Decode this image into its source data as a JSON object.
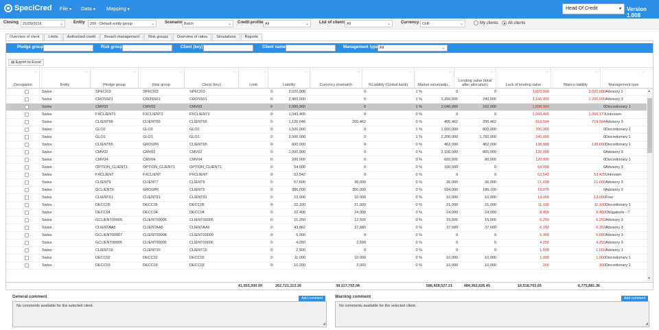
{
  "app": {
    "name": "SpeciCred",
    "version": "Version 1.008",
    "role": "Head Of Credit"
  },
  "menu": [
    "File",
    "Data",
    "Mapping"
  ],
  "filters": {
    "closing_label": "Closing",
    "closing": "21/09/2016",
    "entity_label": "Entity",
    "entity": "200 - Default entity group",
    "scenario_label": "Scenario",
    "scenario": "Batch",
    "credit_profile_label": "Credit profile",
    "credit_profile": "All",
    "list_label": "List of clients",
    "list": "All",
    "currency_label": "Currency",
    "currency": "CHF",
    "my_clients": "My clients",
    "all_clients": "All clients",
    "selected_scope": "all"
  },
  "tabs": [
    "Overview of client",
    "Limits",
    "Authorised credit",
    "Breach management",
    "Risk groups",
    "Overview of ratios",
    "Simulations",
    "Reports"
  ],
  "search": {
    "pledge": "Pledge group",
    "risk": "Risk group",
    "client": "Client (key)",
    "name": "Client name",
    "mtype": "Management type",
    "mtype_value": "All"
  },
  "export": "Export to Excel",
  "columns": [
    "Derogation",
    "Entity",
    "Pledge group",
    "Risk group",
    "Client (key)",
    "Limit",
    "Liability",
    "Currency mismatch",
    "%Liability (Global bank)",
    "Market value(adju...",
    "Lending value (total after allocation)",
    "Lack of lending value",
    "Blanco liability",
    "Management type"
  ],
  "rows": [
    [
      "Swiss",
      "SPECI03",
      "SPECI03",
      "SPECI03",
      "0",
      "3,020,000",
      "0",
      "1 %",
      "0",
      "0",
      "3,020,000",
      "3,020,000",
      "Advisory 2"
    ],
    [
      "Swiss",
      "CROSS01",
      "CROSS01",
      "CROSS01",
      "0",
      "2,400,000",
      "0",
      "1 %",
      "1,200,000",
      "240,000",
      "2,160,000",
      "1,200,000",
      "Advisory 3"
    ],
    [
      "Swiss",
      "CMV03",
      "CMV03",
      "CMV03",
      "0",
      "2,000,000",
      "0",
      "1 %",
      "2,040,000",
      "162,000",
      "1,838,000",
      "0",
      "Discretionary 1"
    ],
    [
      "Swiss",
      "FXCLIENT2",
      "FXCLIENT2",
      "FXCLIENT2",
      "0",
      "1,043,405",
      "0",
      "0 %",
      "0",
      "0",
      "1,043,405",
      "1,066,173",
      "Unknown"
    ],
    [
      "Swiss",
      "CLIENT66",
      "CLIENT66",
      "CLIENT66",
      "0",
      "1,120,046",
      "200,462",
      "0 %",
      "400,462",
      "200,462",
      "919,584",
      "719,584",
      "Advisory 3"
    ],
    [
      "Swiss",
      "GLO2",
      "GLO2",
      "GLO2",
      "0",
      "1,500,000",
      "0",
      "1 %",
      "1,000,000",
      "800,000",
      "700,000",
      "0",
      "Discretionary 1"
    ],
    [
      "Swiss",
      "GLO1",
      "GLO1",
      "GLO1",
      "0",
      "2,000,000",
      "0",
      "1 %",
      "2,200,000",
      "1,760,000",
      "240,000",
      "0",
      "Discretionary 1"
    ],
    [
      "Swiss",
      "CLIENT65",
      "GROUP6",
      "CLIENT65",
      "0",
      "600,000",
      "0",
      "0 %",
      "462,000",
      "462,000",
      "138,000",
      "138,000",
      "Discretionary 1"
    ],
    [
      "Swiss",
      "CMV02",
      "CMV02",
      "CMV02",
      "0",
      "1,000,000",
      "0",
      "0 %",
      "2,100,000",
      "865,000",
      "135,000",
      "0",
      "Advisory 3"
    ],
    [
      "Swiss",
      "CMV04",
      "CMV04",
      "CMV04",
      "0",
      "200,000",
      "0",
      "0 %",
      "600,000",
      "80,000",
      "120,000",
      "0",
      "Discretionary 1"
    ],
    [
      "Swiss",
      "OPTION_CLIENT1",
      "OPTION_CLIENT1",
      "OPTION_CLIENT1",
      "0",
      "54,000",
      "0",
      "0 %",
      "100,000",
      "0",
      "54,000",
      "0",
      "Advisory 3"
    ],
    [
      "Swiss",
      "FXCLIENT",
      "FXCLIENT",
      "FXCLIENT",
      "0",
      "52,542",
      "0",
      "0 %",
      "0",
      "0",
      "52,542",
      "53,425",
      "Unknown"
    ],
    [
      "Swiss",
      "CLIENT9",
      "CLIENT7",
      "CLIENT9",
      "0",
      "57,600",
      "36,000",
      "0 %",
      "36,000",
      "36,000",
      "21,600",
      "21,600",
      "Advisory 3"
    ],
    [
      "Swiss",
      "GCLIENT6",
      "GROUP6",
      "CLIENT6",
      "0",
      "386,000",
      "350,000",
      "0 %",
      "594,000",
      "186,100",
      "19,870",
      "0",
      "Advisory 3"
    ],
    [
      "Swiss",
      "CLIENT91",
      "CLIENT91",
      "CLIENT91",
      "0",
      "23,000",
      "10,000",
      "0 %",
      "10,000",
      "10,000",
      "13,000",
      "13,000",
      "Free"
    ],
    [
      "Swiss",
      "DECC05",
      "DECC05",
      "DECC05",
      "0",
      "32,100",
      "21,000",
      "0 %",
      "21,000",
      "21,000",
      "11,100",
      "11,100",
      "Discretionary 1"
    ],
    [
      "Swiss",
      "DECC04",
      "DECC04",
      "DECC04",
      "0",
      "32,400",
      "24,000",
      "0 %",
      "24,000",
      "24,000",
      "8,400",
      "8,400",
      "Obligations - 7"
    ],
    [
      "Swiss",
      "GCLIENT00005",
      "CLIENT00005",
      "CLIENT00005",
      "0",
      "21,250",
      "12,500",
      "0 %",
      "15,000",
      "15,000",
      "6,250",
      "6,250",
      "Advisory 3"
    ],
    [
      "Swiss",
      "CLIENTAA5",
      "CLIENTAA5",
      "CLIENTAA5",
      "0",
      "43,862",
      "37,680",
      "0 %",
      "37,680",
      "37,680",
      "6,202",
      "6,202",
      "Advisory 3"
    ],
    [
      "Swiss",
      "GCLIENT00007",
      "CLIENT00008",
      "CLIENT00009",
      "0",
      "5,000",
      "0",
      "0 %",
      "0",
      "0",
      "5,000",
      "5,000",
      "Advisory 3"
    ],
    [
      "Swiss",
      "GCLIENT00005",
      "CLIENT00005",
      "CLIENT00006",
      "0",
      "4,250",
      "2,500",
      "0 %",
      "0",
      "0",
      "4,250",
      "4,250",
      "Advisory 3"
    ],
    [
      "Swiss",
      "CLIENT19",
      "CLIENT20",
      "CLIENT19",
      "0",
      "2,500",
      "0",
      "0 %",
      "0",
      "0",
      "1,500",
      "1,500",
      "Advisory 1"
    ],
    [
      "Swiss",
      "DECC02",
      "DECC02",
      "DECC02",
      "0",
      "11,000",
      "10,000",
      "0 %",
      "10,000",
      "10,000",
      "1,000",
      "1,000",
      "Discretionary 1"
    ],
    [
      "Swiss",
      "DECC03",
      "DECC03",
      "DECC03",
      "0",
      "10,200",
      "2,000",
      "0 %",
      "10,000",
      "10,000",
      "200",
      "200",
      "Discretionary 1"
    ]
  ],
  "totals": {
    "limit": "41,003,300.00",
    "liability": "262,721,113.26",
    "currency": "38,117,702.08",
    "market": "586,428,527.21",
    "lending": "484,362,626.45",
    "lack": "10,518,703.65",
    "blanco": "6,775,881.36"
  },
  "general_comment": {
    "title": "General comment",
    "button": "Add comment",
    "text": "No comments available for the selected client."
  },
  "warning_comment": {
    "title": "Warning comment",
    "button": "Add comment",
    "text": "No comments available for the selected client."
  }
}
